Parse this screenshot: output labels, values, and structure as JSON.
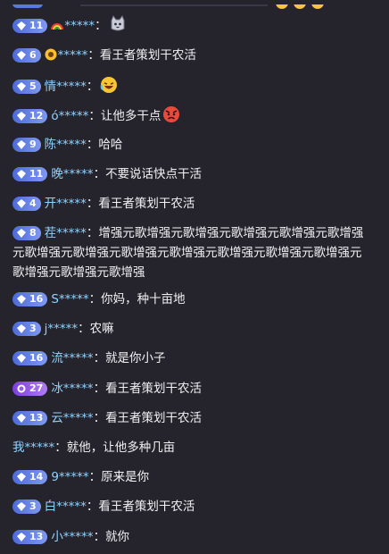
{
  "chat": {
    "messages": [
      {
        "level": "",
        "user": "",
        "separator": "",
        "text": "",
        "partial": true
      },
      {
        "level": "11",
        "user": "*****",
        "separator": "：",
        "text": "",
        "emoji": "cat-face",
        "prefix_icon": "rainbow"
      },
      {
        "level": "6",
        "user": "*****",
        "separator": "：",
        "text": "看王者策划干农活",
        "prefix_icon": "sunflower"
      },
      {
        "level": "5",
        "user": "情*****",
        "separator": "：",
        "text": "",
        "emoji": "rofl-face"
      },
      {
        "level": "12",
        "user": "ó*****",
        "separator": "：",
        "text": "让他多干点",
        "emoji": "angry-face"
      },
      {
        "level": "9",
        "user": "陈*****",
        "separator": "：",
        "text": "哈哈"
      },
      {
        "level": "11",
        "user": "晚*****",
        "separator": "：",
        "text": "不要说话快点干活"
      },
      {
        "level": "4",
        "user": "开*****",
        "separator": "：",
        "text": "看王者策划干农活"
      },
      {
        "level": "8",
        "user": "茬*****",
        "separator": "：",
        "text": "增强元歌增强元歌增强元歌增强元歌增强元歌增强元歌增强元歌增强元歌增强元歌增强元歌增强元歌增强元歌增强元歌增强元歌增强元歌增强"
      },
      {
        "level": "16",
        "user": "S*****",
        "separator": "：",
        "text": "你妈，种十亩地"
      },
      {
        "level": "3",
        "user": "j*****",
        "separator": "：",
        "text": "农嘛"
      },
      {
        "level": "16",
        "user": "流*****",
        "separator": "：",
        "text": "就是你小子"
      },
      {
        "level": "27",
        "user": "冰*****",
        "separator": "：",
        "text": "看王者策划干农活",
        "badge_style": "purple"
      },
      {
        "level": "13",
        "user": "云*****",
        "separator": "：",
        "text": "看王者策划干农活"
      },
      {
        "level": "",
        "user": "我*****",
        "separator": "：",
        "text": "就他，让他多种几亩"
      },
      {
        "level": "14",
        "user": "9*****",
        "separator": "：",
        "text": "原来是你"
      },
      {
        "level": "3",
        "user": "白*****",
        "separator": "：",
        "text": "看王者策划干农活"
      },
      {
        "level": "13",
        "user": "小*****",
        "separator": "：",
        "text": "就你"
      }
    ]
  },
  "colors": {
    "background": "#25242d",
    "username": "#8fd3ff",
    "text": "#f2f2f4",
    "badge_blue": "#5a78e0",
    "badge_purple": "#9a5ae6"
  }
}
